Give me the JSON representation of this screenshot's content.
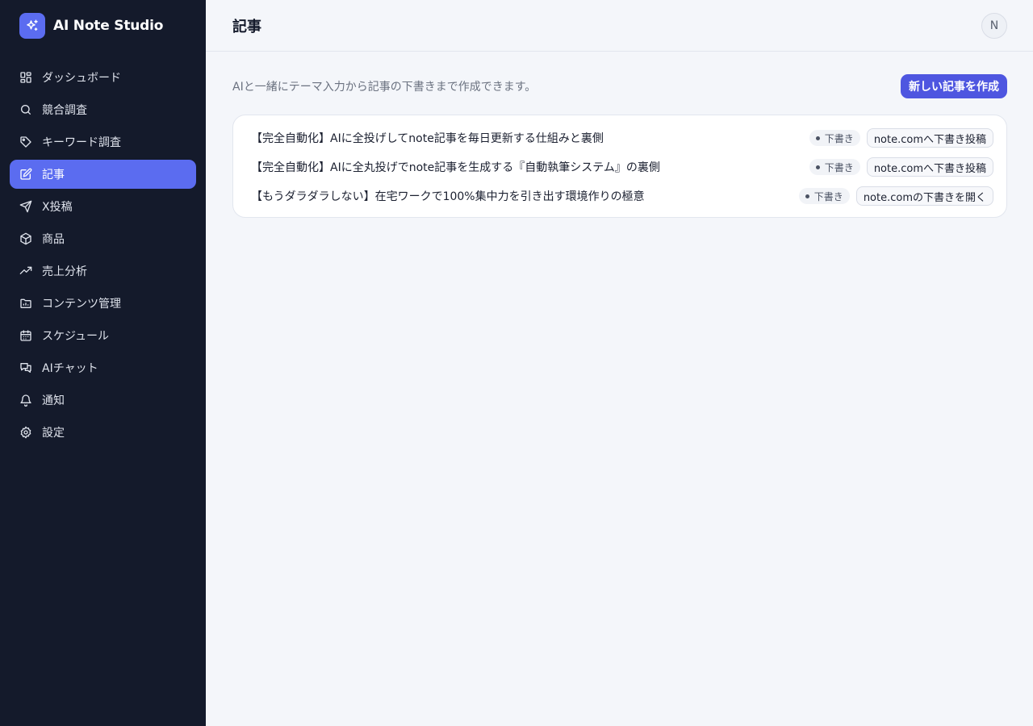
{
  "brand": {
    "name": "AI Note Studio",
    "icon": "sparkles-icon",
    "color": "#5b6cf0"
  },
  "sidebar": {
    "items": [
      {
        "label": "ダッシュボード",
        "icon": "dashboard-grid-icon",
        "active": false
      },
      {
        "label": "競合調査",
        "icon": "search-icon",
        "active": false
      },
      {
        "label": "キーワード調査",
        "icon": "tag-icon",
        "active": false
      },
      {
        "label": "記事",
        "icon": "edit-icon",
        "active": true
      },
      {
        "label": "X投稿",
        "icon": "send-icon",
        "active": false
      },
      {
        "label": "商品",
        "icon": "package-icon",
        "active": false
      },
      {
        "label": "売上分析",
        "icon": "trending-up-icon",
        "active": false
      },
      {
        "label": "コンテンツ管理",
        "icon": "folder-icon",
        "active": false
      },
      {
        "label": "スケジュール",
        "icon": "calendar-icon",
        "active": false
      },
      {
        "label": "AIチャット",
        "icon": "chat-icon",
        "active": false
      },
      {
        "label": "通知",
        "icon": "bell-icon",
        "active": false
      },
      {
        "label": "設定",
        "icon": "gear-icon",
        "active": false
      }
    ]
  },
  "header": {
    "title": "記事",
    "avatar_initial": "N"
  },
  "main": {
    "intro": "AIと一緒にテーマ入力から記事の下書きまで作成できます。",
    "new_button": "新しい記事を作成",
    "articles": [
      {
        "title": "【完全自動化】AIに全投げしてnote記事を毎日更新する仕組みと裏側",
        "status": "下書き",
        "action": "note.comへ下書き投稿"
      },
      {
        "title": "【完全自動化】AIに全丸投げでnote記事を生成する『自動執筆システム』の裏側",
        "status": "下書き",
        "action": "note.comへ下書き投稿"
      },
      {
        "title": "【もうダラダラしない】在宅ワークで100%集中力を引き出す環境作りの極意",
        "status": "下書き",
        "action": "note.comの下書きを開く"
      }
    ]
  },
  "colors": {
    "sidebar_bg": "#141a2b",
    "accent": "#5b6cf0",
    "primary_button": "#4e56e0"
  }
}
